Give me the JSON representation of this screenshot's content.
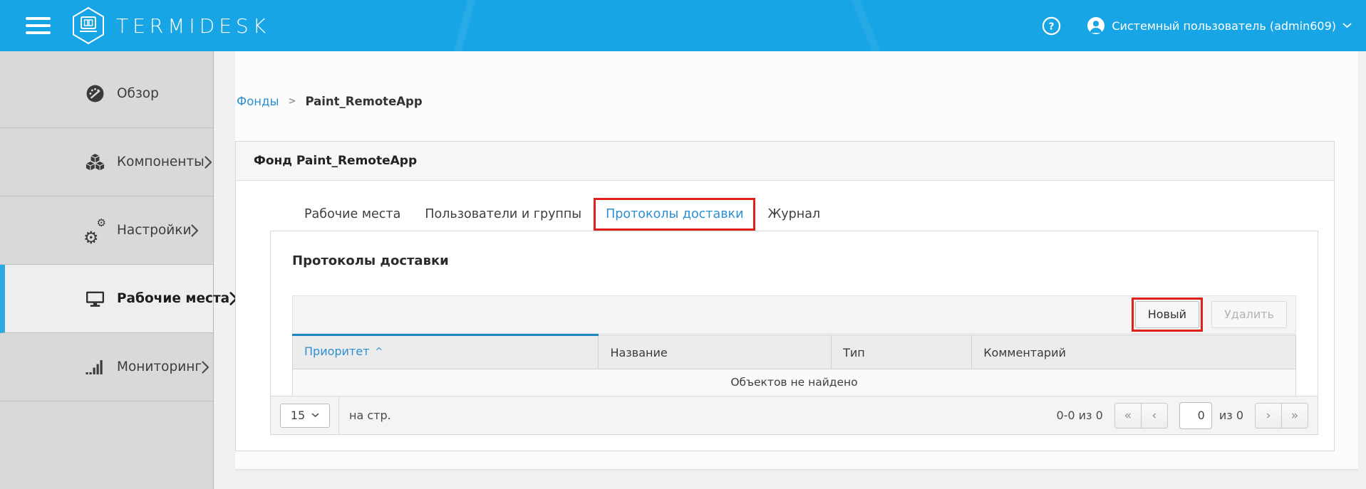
{
  "header": {
    "brand": "TERMIDESK",
    "help_label": "?",
    "user_name": "Системный пользователь (admin609)"
  },
  "sidebar": {
    "items": [
      {
        "label": "Обзор",
        "icon": "gauge",
        "expandable": false,
        "active": false
      },
      {
        "label": "Компоненты",
        "icon": "cubes",
        "expandable": true,
        "active": false
      },
      {
        "label": "Настройки",
        "icon": "gears",
        "expandable": true,
        "active": false
      },
      {
        "label": "Рабочие места",
        "icon": "monitor",
        "expandable": true,
        "active": true
      },
      {
        "label": "Мониторинг",
        "icon": "signal-bars",
        "expandable": true,
        "active": false
      }
    ]
  },
  "breadcrumb": {
    "root": "Фонды",
    "separator": ">",
    "current": "Paint_RemoteApp"
  },
  "card": {
    "title": "Фонд Paint_RemoteApp",
    "tabs": [
      {
        "label": "Рабочие места",
        "active": false,
        "annotated": false
      },
      {
        "label": "Пользователи и группы",
        "active": false,
        "annotated": false
      },
      {
        "label": "Протоколы доставки",
        "active": true,
        "annotated": true
      },
      {
        "label": "Журнал",
        "active": false,
        "annotated": false
      }
    ]
  },
  "panel": {
    "title": "Протоколы доставки",
    "toolbar": {
      "new_button": "Новый",
      "delete_button": "Удалить"
    },
    "table": {
      "columns": [
        {
          "label": "Приоритет",
          "sorted": true,
          "sort_caret": "^"
        },
        {
          "label": "Название",
          "sorted": false
        },
        {
          "label": "Тип",
          "sorted": false
        },
        {
          "label": "Комментарий",
          "sorted": false
        }
      ],
      "rows": [],
      "empty_text": "Объектов не найдено"
    },
    "pagination": {
      "page_size": "15",
      "per_page_label": "на стр.",
      "range_text": "0-0 из 0",
      "first_symbol": "«",
      "prev_symbol": "‹",
      "page_input_value": "0",
      "of_total_label": "из 0",
      "next_symbol": "›",
      "last_symbol": "»"
    }
  },
  "colors": {
    "header_blue": "#18a5e5",
    "accent_blue": "#2e8fd0",
    "annotation_red": "#e0201b"
  },
  "annotations": {
    "highlighted_tab": "Протоколы доставки",
    "highlighted_button": "Новый"
  }
}
